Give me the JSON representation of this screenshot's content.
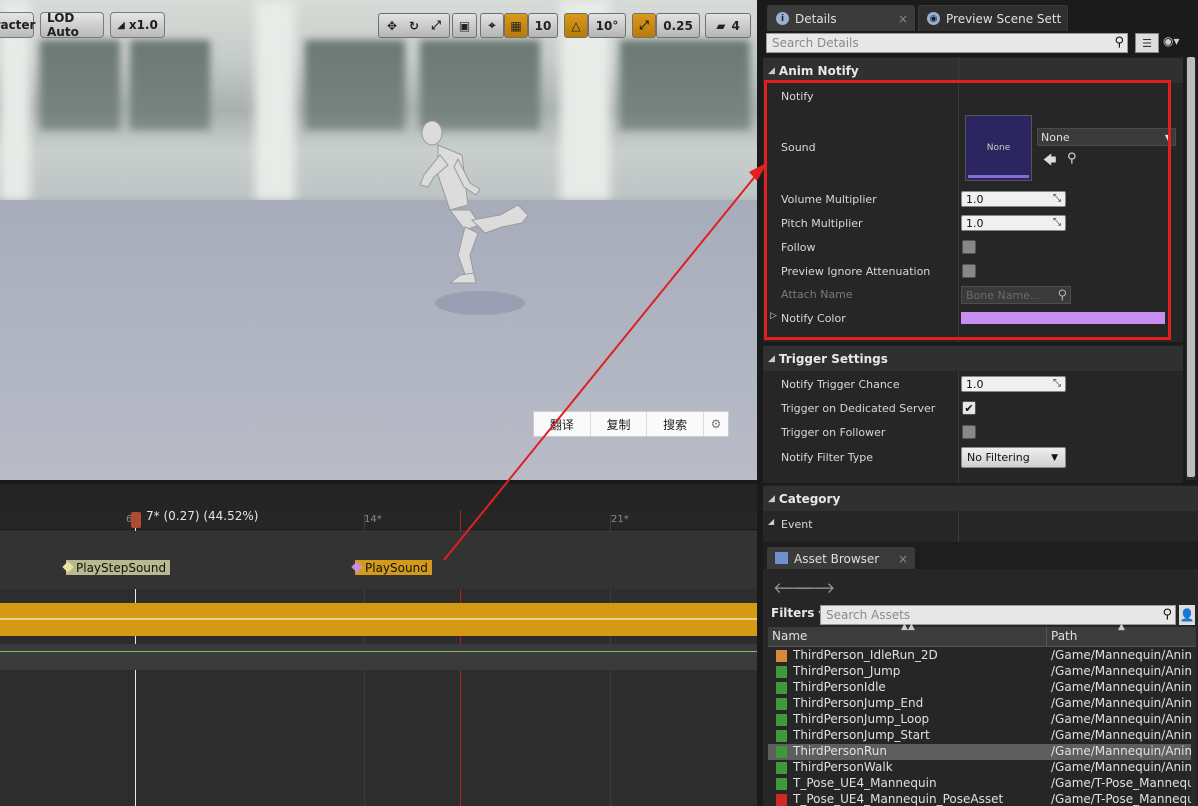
{
  "viewport": {
    "toolbar": {
      "character_label": "racter",
      "lod_label": "LOD Auto",
      "speed_label": "x1.0",
      "grid_snap": "10",
      "rot_snap": "10°",
      "scale_snap": "0.25",
      "cam_speed": "4"
    },
    "context_menu": [
      "翻译",
      "复制",
      "搜索"
    ]
  },
  "timeline": {
    "playhead_label": "7* (0.27) (44.52%)",
    "ticks": [
      "6",
      "14*",
      "21*"
    ],
    "notifies": [
      {
        "label": "PlayStepSound"
      },
      {
        "label": "PlaySound"
      }
    ]
  },
  "details": {
    "tabs": [
      {
        "label": "Details"
      },
      {
        "label": "Preview Scene Sett"
      }
    ],
    "search_placeholder": "Search Details",
    "anim_notify": {
      "title": "Anim Notify",
      "notify_label": "Notify",
      "sound_label": "Sound",
      "sound_thumb": "None",
      "sound_value": "None",
      "volume_label": "Volume Multiplier",
      "volume_value": "1.0",
      "pitch_label": "Pitch Multiplier",
      "pitch_value": "1.0",
      "follow_label": "Follow",
      "preview_atten_label": "Preview Ignore Attenuation",
      "attach_label": "Attach Name",
      "attach_placeholder": "Bone Name...",
      "color_label": "Notify Color",
      "color_value": "#c88ff0"
    },
    "trigger": {
      "title": "Trigger Settings",
      "chance_label": "Notify Trigger Chance",
      "chance_value": "1.0",
      "dedicated_label": "Trigger on Dedicated Server",
      "dedicated_checked": true,
      "follower_label": "Trigger on Follower",
      "follower_checked": false,
      "filter_label": "Notify Filter Type",
      "filter_value": "No Filtering"
    },
    "category": {
      "title": "Category",
      "event_label": "Event"
    }
  },
  "asset_browser": {
    "tab_label": "Asset Browser",
    "filters_label": "Filters",
    "search_placeholder": "Search Assets",
    "col_name": "Name",
    "col_path": "Path",
    "rows": [
      {
        "name": "ThirdPerson_IdleRun_2D",
        "path": "/Game/Mannequin/Anima",
        "icon": "blendspace"
      },
      {
        "name": "ThirdPerson_Jump",
        "path": "/Game/Mannequin/Anima",
        "icon": "anim"
      },
      {
        "name": "ThirdPersonIdle",
        "path": "/Game/Mannequin/Anima",
        "icon": "anim"
      },
      {
        "name": "ThirdPersonJump_End",
        "path": "/Game/Mannequin/Anima",
        "icon": "anim"
      },
      {
        "name": "ThirdPersonJump_Loop",
        "path": "/Game/Mannequin/Anima",
        "icon": "anim"
      },
      {
        "name": "ThirdPersonJump_Start",
        "path": "/Game/Mannequin/Anima",
        "icon": "anim"
      },
      {
        "name": "ThirdPersonRun",
        "path": "/Game/Mannequin/Anima",
        "icon": "anim-active",
        "selected": true
      },
      {
        "name": "ThirdPersonWalk",
        "path": "/Game/Mannequin/Anima",
        "icon": "anim"
      },
      {
        "name": "T_Pose_UE4_Mannequin",
        "path": "/Game/T-Pose_Mannequi",
        "icon": "anim"
      },
      {
        "name": "T_Pose_UE4_Mannequin_PoseAsset",
        "path": "/Game/T-Pose_Mannequi",
        "icon": "pose"
      }
    ]
  },
  "colors": {
    "highlight": "#e02020",
    "notify_track": "#d09a10",
    "accent_orange": "#c9870e"
  }
}
